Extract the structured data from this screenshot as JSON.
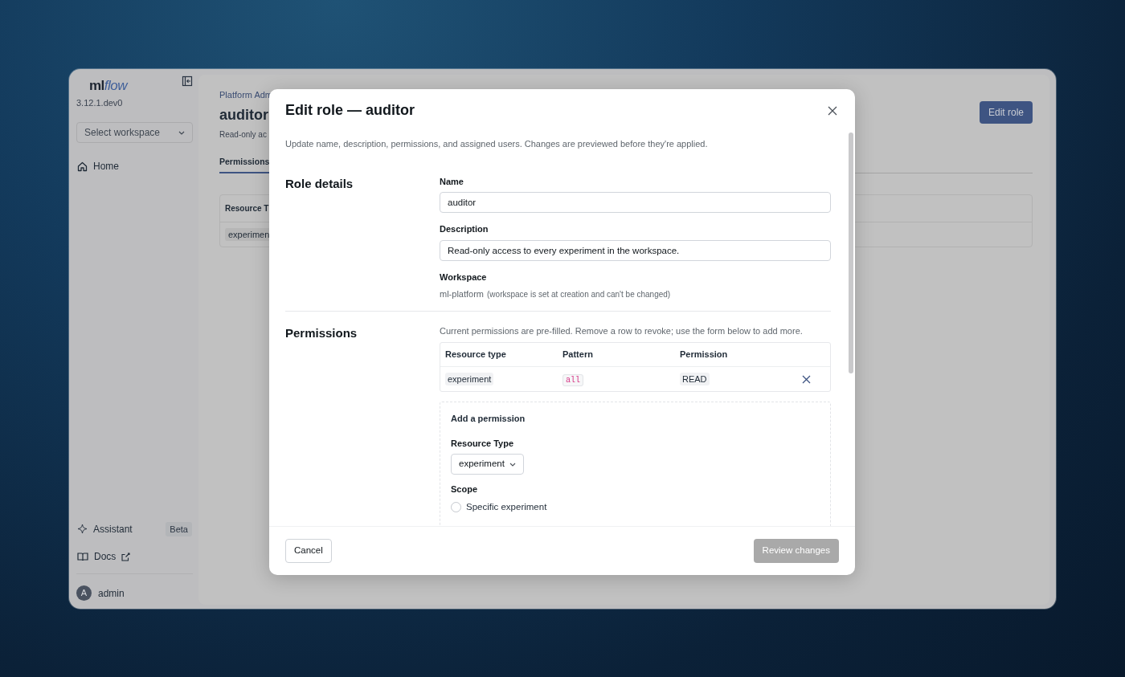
{
  "sidebar": {
    "logo_main": "ml",
    "logo_accent": "flow",
    "version": "3.12.1.dev0",
    "workspace_select": {
      "placeholder": "Select workspace"
    },
    "nav": [
      {
        "label": "Home",
        "selected": false
      }
    ],
    "footer_items": [
      {
        "label": "Assistant",
        "badge": "Beta",
        "kind": "beta"
      },
      {
        "label": "Docs",
        "kind": "external"
      }
    ],
    "user": {
      "initial": "A",
      "name": "admin"
    }
  },
  "page": {
    "breadcrumb": "Platform Adm",
    "title": "auditor",
    "subtitle": "Read-only ac",
    "edit_button": "Edit role",
    "tabs": [
      {
        "label": "Permissions",
        "selected": true
      }
    ],
    "table": {
      "columns": [
        "Resource T"
      ],
      "rows": [
        [
          "experimen"
        ]
      ]
    }
  },
  "modal": {
    "title": "Edit role — auditor",
    "intro": "Update name, description, permissions, and assigned users. Changes are previewed before they're applied.",
    "role_details": {
      "heading": "Role details",
      "name": {
        "label": "Name",
        "value": "auditor"
      },
      "description": {
        "label": "Description",
        "value": "Read-only access to every experiment in the workspace."
      },
      "workspace": {
        "label": "Workspace",
        "value": "ml-platform",
        "note": "(workspace is set at creation and can't be changed)"
      }
    },
    "permissions": {
      "heading": "Permissions",
      "hint": "Current permissions are pre-filled. Remove a row to revoke; use the form below to add more.",
      "columns": [
        "Resource type",
        "Pattern",
        "Permission"
      ],
      "rows": [
        {
          "resource_type": "experiment",
          "pattern": "all",
          "permission": "READ"
        }
      ],
      "add_form": {
        "title": "Add a permission",
        "resource_type": {
          "label": "Resource Type",
          "value": "experiment"
        },
        "scope": {
          "label": "Scope",
          "options": [
            {
              "label": "Specific experiment",
              "selected": false
            }
          ]
        }
      }
    },
    "buttons": {
      "cancel": "Cancel",
      "review": {
        "label": "Review changes",
        "disabled": true
      }
    }
  }
}
